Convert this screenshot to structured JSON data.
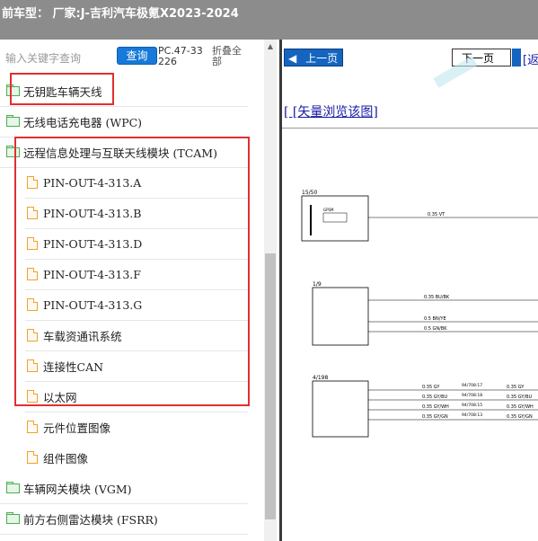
{
  "header": {
    "title": "前车型：  厂家:J-吉利汽车极氪X2023-2024"
  },
  "search": {
    "placeholder": "输入关键字查询",
    "button": "查询",
    "code": "PC.47-33226",
    "collapse": "折叠全部"
  },
  "tree": [
    {
      "label": "无钥匙车辆天线",
      "type": "folder"
    },
    {
      "label": "无线电话充电器 (WPC)",
      "type": "folder"
    },
    {
      "label": "远程信息处理与互联天线模块 (TCAM)",
      "type": "folder"
    },
    {
      "label": "PIN-OUT-4-313.A",
      "type": "doc"
    },
    {
      "label": "PIN-OUT-4-313.B",
      "type": "doc"
    },
    {
      "label": "PIN-OUT-4-313.D",
      "type": "doc"
    },
    {
      "label": "PIN-OUT-4-313.F",
      "type": "doc"
    },
    {
      "label": "PIN-OUT-4-313.G",
      "type": "doc"
    },
    {
      "label": "车载资通讯系统",
      "type": "doc"
    },
    {
      "label": "连接性CAN",
      "type": "doc"
    },
    {
      "label": "以太网",
      "type": "doc"
    },
    {
      "label": "元件位置图像",
      "type": "doc"
    },
    {
      "label": "组件图像",
      "type": "doc"
    },
    {
      "label": "车辆网关模块 (VGM)",
      "type": "folder"
    },
    {
      "label": "前方右侧雷达模块 (FSRR)",
      "type": "folder"
    }
  ],
  "viewer": {
    "prev": "上一页",
    "next": "下一页",
    "link_fragment": "[返",
    "vector_link": "[ [矢量浏览该图]",
    "diagram": {
      "blocks": [
        {
          "id": "15/50"
        },
        {
          "id": "1/9"
        },
        {
          "id": "4/198"
        }
      ],
      "wires": [
        {
          "label": "0.35 VT"
        },
        {
          "label": "0.35 BU/BK"
        },
        {
          "label": "0.5 BN/YE"
        },
        {
          "label": "0.5 GN/BK"
        },
        {
          "label": "0.35 GY"
        },
        {
          "label": "0.35 GY/BU"
        },
        {
          "label": "0.35 GY/WH"
        },
        {
          "label": "0.35 GY/GN"
        }
      ],
      "splices": [
        "94/708:17",
        "94/708:18",
        "94/708:15",
        "94/708:13"
      ],
      "right_labels": [
        "0.35 GY",
        "0.35 GY/BU",
        "0.35 GY/WH",
        "0.35 GY/GN"
      ],
      "inner_label": "GPSM"
    }
  }
}
